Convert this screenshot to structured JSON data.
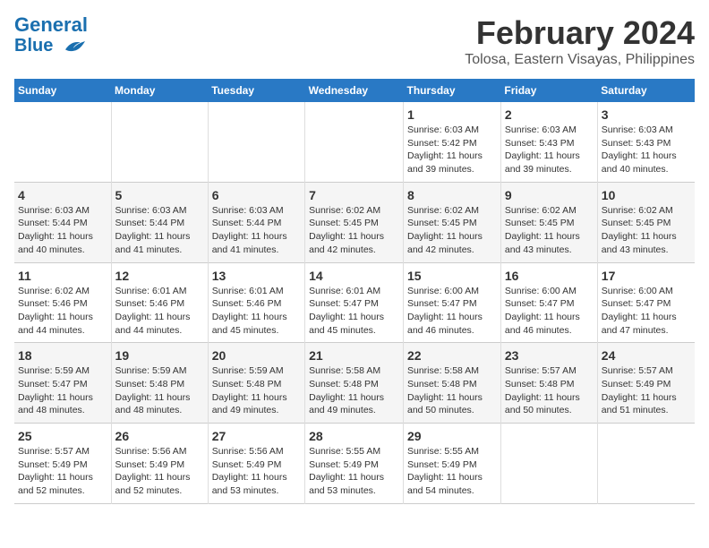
{
  "header": {
    "logo_line1": "General",
    "logo_line2": "Blue",
    "month": "February 2024",
    "location": "Tolosa, Eastern Visayas, Philippines"
  },
  "weekdays": [
    "Sunday",
    "Monday",
    "Tuesday",
    "Wednesday",
    "Thursday",
    "Friday",
    "Saturday"
  ],
  "weeks": [
    [
      {
        "day": "",
        "detail": ""
      },
      {
        "day": "",
        "detail": ""
      },
      {
        "day": "",
        "detail": ""
      },
      {
        "day": "",
        "detail": ""
      },
      {
        "day": "1",
        "detail": "Sunrise: 6:03 AM\nSunset: 5:42 PM\nDaylight: 11 hours\nand 39 minutes."
      },
      {
        "day": "2",
        "detail": "Sunrise: 6:03 AM\nSunset: 5:43 PM\nDaylight: 11 hours\nand 39 minutes."
      },
      {
        "day": "3",
        "detail": "Sunrise: 6:03 AM\nSunset: 5:43 PM\nDaylight: 11 hours\nand 40 minutes."
      }
    ],
    [
      {
        "day": "4",
        "detail": "Sunrise: 6:03 AM\nSunset: 5:44 PM\nDaylight: 11 hours\nand 40 minutes."
      },
      {
        "day": "5",
        "detail": "Sunrise: 6:03 AM\nSunset: 5:44 PM\nDaylight: 11 hours\nand 41 minutes."
      },
      {
        "day": "6",
        "detail": "Sunrise: 6:03 AM\nSunset: 5:44 PM\nDaylight: 11 hours\nand 41 minutes."
      },
      {
        "day": "7",
        "detail": "Sunrise: 6:02 AM\nSunset: 5:45 PM\nDaylight: 11 hours\nand 42 minutes."
      },
      {
        "day": "8",
        "detail": "Sunrise: 6:02 AM\nSunset: 5:45 PM\nDaylight: 11 hours\nand 42 minutes."
      },
      {
        "day": "9",
        "detail": "Sunrise: 6:02 AM\nSunset: 5:45 PM\nDaylight: 11 hours\nand 43 minutes."
      },
      {
        "day": "10",
        "detail": "Sunrise: 6:02 AM\nSunset: 5:45 PM\nDaylight: 11 hours\nand 43 minutes."
      }
    ],
    [
      {
        "day": "11",
        "detail": "Sunrise: 6:02 AM\nSunset: 5:46 PM\nDaylight: 11 hours\nand 44 minutes."
      },
      {
        "day": "12",
        "detail": "Sunrise: 6:01 AM\nSunset: 5:46 PM\nDaylight: 11 hours\nand 44 minutes."
      },
      {
        "day": "13",
        "detail": "Sunrise: 6:01 AM\nSunset: 5:46 PM\nDaylight: 11 hours\nand 45 minutes."
      },
      {
        "day": "14",
        "detail": "Sunrise: 6:01 AM\nSunset: 5:47 PM\nDaylight: 11 hours\nand 45 minutes."
      },
      {
        "day": "15",
        "detail": "Sunrise: 6:00 AM\nSunset: 5:47 PM\nDaylight: 11 hours\nand 46 minutes."
      },
      {
        "day": "16",
        "detail": "Sunrise: 6:00 AM\nSunset: 5:47 PM\nDaylight: 11 hours\nand 46 minutes."
      },
      {
        "day": "17",
        "detail": "Sunrise: 6:00 AM\nSunset: 5:47 PM\nDaylight: 11 hours\nand 47 minutes."
      }
    ],
    [
      {
        "day": "18",
        "detail": "Sunrise: 5:59 AM\nSunset: 5:47 PM\nDaylight: 11 hours\nand 48 minutes."
      },
      {
        "day": "19",
        "detail": "Sunrise: 5:59 AM\nSunset: 5:48 PM\nDaylight: 11 hours\nand 48 minutes."
      },
      {
        "day": "20",
        "detail": "Sunrise: 5:59 AM\nSunset: 5:48 PM\nDaylight: 11 hours\nand 49 minutes."
      },
      {
        "day": "21",
        "detail": "Sunrise: 5:58 AM\nSunset: 5:48 PM\nDaylight: 11 hours\nand 49 minutes."
      },
      {
        "day": "22",
        "detail": "Sunrise: 5:58 AM\nSunset: 5:48 PM\nDaylight: 11 hours\nand 50 minutes."
      },
      {
        "day": "23",
        "detail": "Sunrise: 5:57 AM\nSunset: 5:48 PM\nDaylight: 11 hours\nand 50 minutes."
      },
      {
        "day": "24",
        "detail": "Sunrise: 5:57 AM\nSunset: 5:49 PM\nDaylight: 11 hours\nand 51 minutes."
      }
    ],
    [
      {
        "day": "25",
        "detail": "Sunrise: 5:57 AM\nSunset: 5:49 PM\nDaylight: 11 hours\nand 52 minutes."
      },
      {
        "day": "26",
        "detail": "Sunrise: 5:56 AM\nSunset: 5:49 PM\nDaylight: 11 hours\nand 52 minutes."
      },
      {
        "day": "27",
        "detail": "Sunrise: 5:56 AM\nSunset: 5:49 PM\nDaylight: 11 hours\nand 53 minutes."
      },
      {
        "day": "28",
        "detail": "Sunrise: 5:55 AM\nSunset: 5:49 PM\nDaylight: 11 hours\nand 53 minutes."
      },
      {
        "day": "29",
        "detail": "Sunrise: 5:55 AM\nSunset: 5:49 PM\nDaylight: 11 hours\nand 54 minutes."
      },
      {
        "day": "",
        "detail": ""
      },
      {
        "day": "",
        "detail": ""
      }
    ]
  ]
}
